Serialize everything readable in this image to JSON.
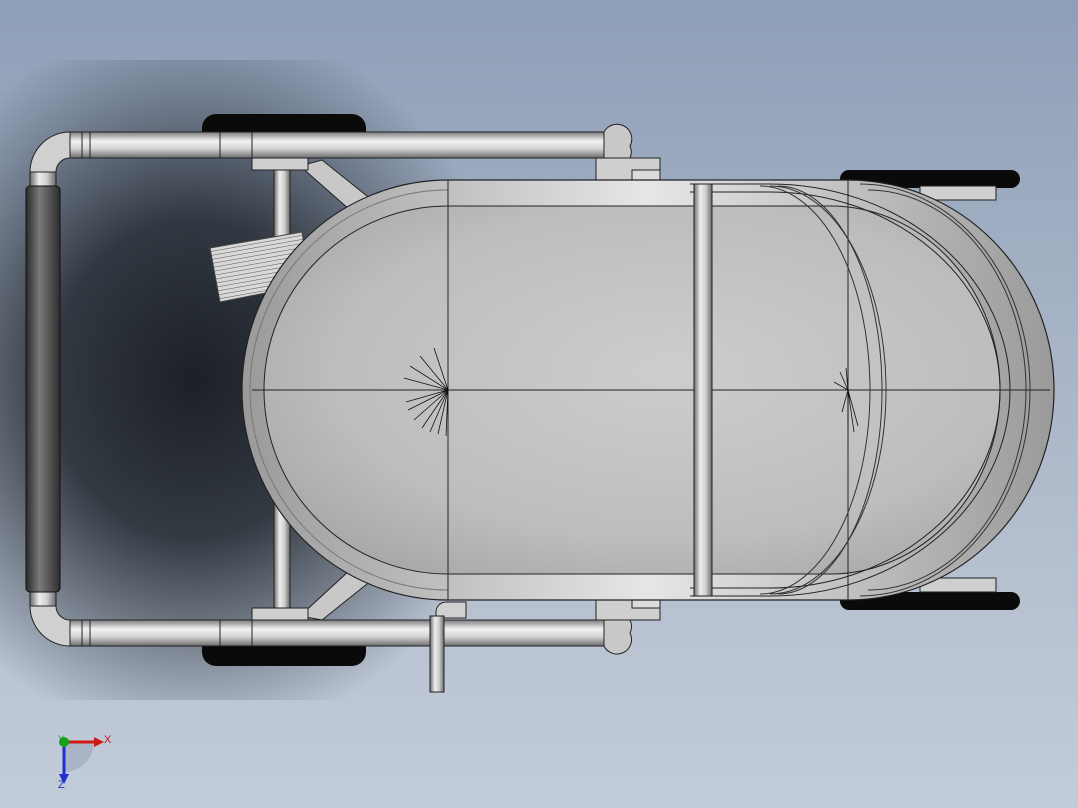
{
  "viewport": {
    "background_top": "#8e9fb8",
    "background_bottom": "#c3ccd9"
  },
  "model": {
    "colors": {
      "tube_light": "#f2f2f2",
      "tube_mid": "#c4c4c4",
      "tube_dark": "#7c7c7c",
      "wheel": "#0a0a0a",
      "outline": "#1a1a1a"
    }
  },
  "triad": {
    "x_label": "X",
    "y_label": "Y",
    "z_label": "Z",
    "x_color": "#d01818",
    "y_color": "#18a018",
    "z_color": "#2030d0"
  }
}
